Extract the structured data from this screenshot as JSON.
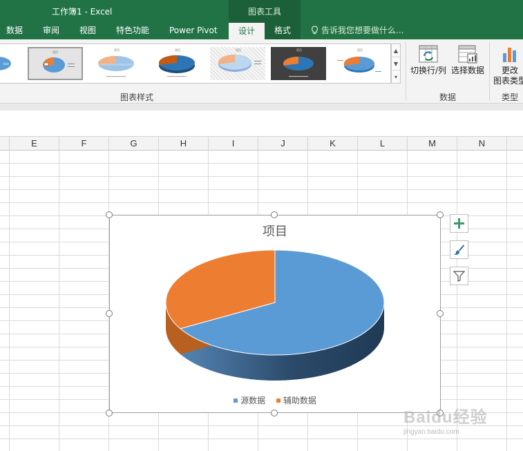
{
  "window": {
    "title": "工作簿1 - Excel",
    "context_group": "图表工具"
  },
  "tabs": [
    {
      "label": "数据"
    },
    {
      "label": "审阅"
    },
    {
      "label": "视图"
    },
    {
      "label": "特色功能"
    },
    {
      "label": "Power Pivot"
    },
    {
      "label": "设计"
    },
    {
      "label": "格式"
    }
  ],
  "tell_me": {
    "placeholder": "告诉我您想要做什么..."
  },
  "ribbon": {
    "styles_group": "图表样式",
    "data_group": "数据",
    "type_group": "类型",
    "switch_row_col": "切换行/列",
    "select_data": "选择数据",
    "change_type_line1": "更改",
    "change_type_line2": "图表类型"
  },
  "columns": [
    "E",
    "F",
    "G",
    "H",
    "I",
    "J",
    "K",
    "L",
    "M",
    "N"
  ],
  "chart_data": {
    "type": "pie",
    "title": "项目",
    "categories": [
      "源数据",
      "辅助数据"
    ],
    "values": [
      66.7,
      33.3
    ],
    "colors": [
      "#5b9bd5",
      "#ed7d31"
    ],
    "legend_position": "bottom",
    "three_d": true
  },
  "watermark": {
    "text": "Baidu经验",
    "url": "jingyan.baidu.com"
  }
}
